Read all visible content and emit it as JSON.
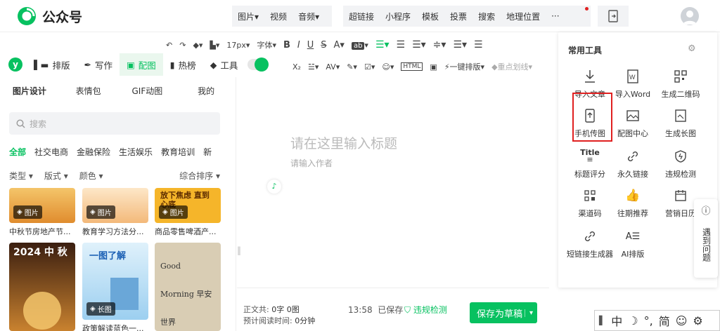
{
  "app": {
    "title": "公众号"
  },
  "insert_menu": {
    "group1": [
      "图片",
      "视频",
      "音频"
    ],
    "group2": [
      "超链接",
      "小程序",
      "模板",
      "投票",
      "搜索",
      "地理位置",
      "···"
    ]
  },
  "format_toolbar": {
    "font_size": "17px",
    "font_family": "字体",
    "one_click_layout": "一键排版",
    "highlight": "重点划线"
  },
  "plugin_tabs": [
    {
      "label": "排版"
    },
    {
      "label": "写作"
    },
    {
      "label": "配图"
    },
    {
      "label": "热榜"
    },
    {
      "label": "工具"
    }
  ],
  "left_panel": {
    "subtabs": [
      "图片设计",
      "表情包",
      "GIF动图",
      "我的"
    ],
    "search_placeholder": "搜索",
    "categories": [
      "全部",
      "社交电商",
      "金融保险",
      "生活娱乐",
      "教育培训"
    ],
    "filters": {
      "type": "类型",
      "format": "版式",
      "color": "颜色",
      "sort": "综合排序"
    },
    "cards": [
      {
        "badge": "图片",
        "caption": "中秋节房地产节...",
        "thumb_text": ""
      },
      {
        "badge": "图片",
        "caption": "教育学习方法分...",
        "thumb_text": ""
      },
      {
        "badge": "图片",
        "caption": "商品零售啤酒产...",
        "thumb_text": "放下焦虑 直到心底"
      },
      {
        "badge": "",
        "caption": "",
        "thumb_text": "2024 中 秋"
      },
      {
        "badge": "长图",
        "caption": "政策解读蓝色一...",
        "thumb_text": "一图了解"
      },
      {
        "badge": "",
        "caption": "",
        "thumb_text": "Good Morning 早安 世界"
      }
    ]
  },
  "editor": {
    "title_placeholder": "请在这里输入标题",
    "author_placeholder": "请输入作者"
  },
  "footer": {
    "word_count_label": "正文共:",
    "word_count": "0字 0图",
    "read_time_label": "预计阅读时间:",
    "read_time": "0分钟",
    "saved_time": "13:58",
    "saved_label": "已保存",
    "violation_check": "违规检测",
    "save_draft": "保存为草稿"
  },
  "tools_panel": {
    "title": "常用工具",
    "items": [
      {
        "label": "导入文章"
      },
      {
        "label": "导入Word"
      },
      {
        "label": "生成二维码"
      },
      {
        "label": "手机传图"
      },
      {
        "label": "配图中心"
      },
      {
        "label": "生成长图"
      },
      {
        "label": "标题评分"
      },
      {
        "label": "永久链接"
      },
      {
        "label": "违规检测"
      },
      {
        "label": "渠道码"
      },
      {
        "label": "往期推荐"
      },
      {
        "label": "营销日历"
      },
      {
        "label": "短链接生成器"
      },
      {
        "label": "AI排版"
      }
    ]
  },
  "help_button": {
    "label": "遇到问题"
  },
  "ime_bar": {
    "chars": [
      "中",
      "°,",
      "简"
    ]
  },
  "colors": {
    "brand_green": "#07c160",
    "highlight_red": "#e02020"
  }
}
